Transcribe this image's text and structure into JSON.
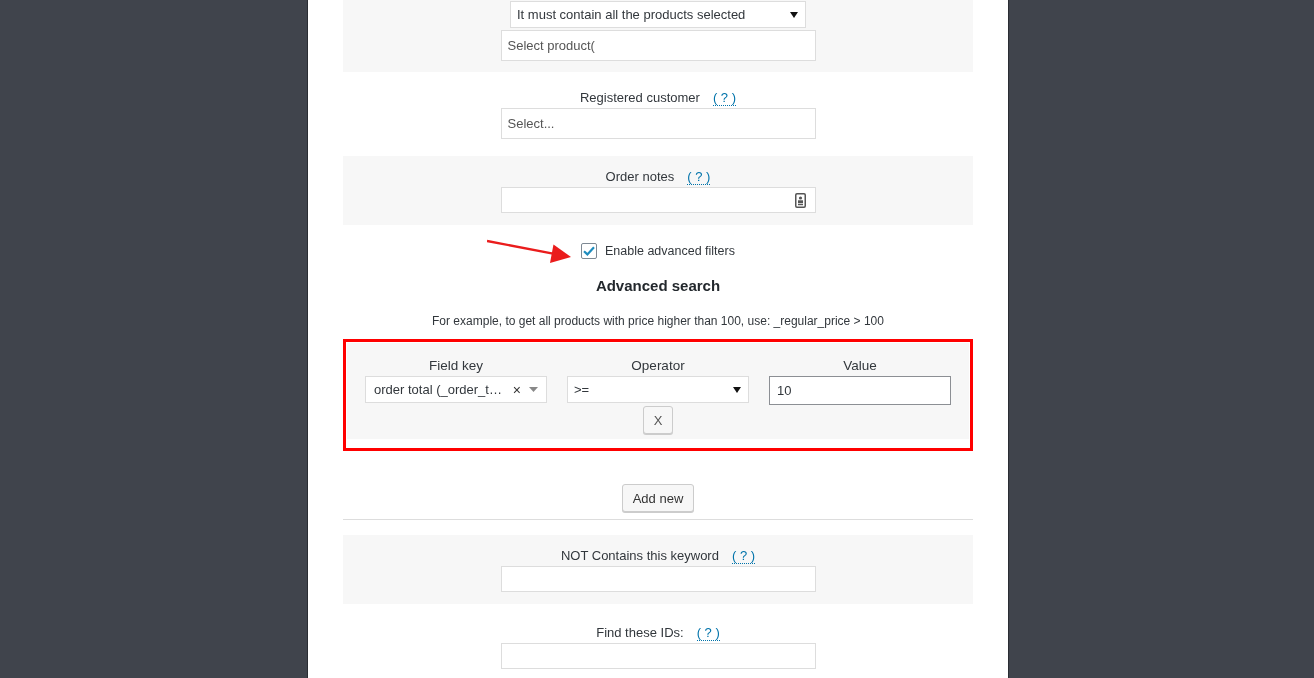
{
  "modal": {
    "top_filters": [
      {
        "kind": "match_select",
        "select_value": "It must contain all the products selected",
        "placeholder": "Select product("
      },
      {
        "kind": "select",
        "label": "Registered customer",
        "help": "( ? )",
        "placeholder": "Select..."
      },
      {
        "kind": "text",
        "label": "Order notes",
        "help": "( ? )",
        "autofill_icon": true
      }
    ],
    "advanced": {
      "enable_checkbox": {
        "label": "Enable advanced filters",
        "checked": true
      },
      "title": "Advanced search",
      "hint": "For example, to get all products with price higher than 100, use: _regular_price > 100",
      "filters": [
        {
          "field_key": {
            "label": "Field key",
            "value": "order total (_order_t…",
            "clear": "×"
          },
          "operator": {
            "label": "Operator",
            "value": ">="
          },
          "value": {
            "label": "Value",
            "value": "10"
          },
          "remove": "X"
        }
      ],
      "add_button": "Add new"
    },
    "bottom_filters": [
      {
        "kind": "text",
        "label": "NOT Contains this keyword",
        "help": "( ? )"
      },
      {
        "kind": "text",
        "label": "Find these IDs:",
        "help": "( ? )"
      }
    ]
  }
}
